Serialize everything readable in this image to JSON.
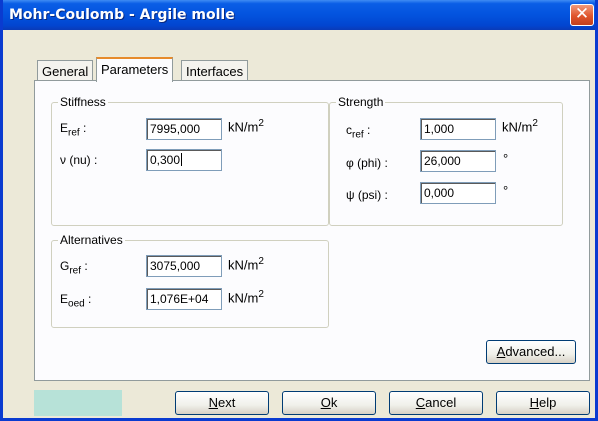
{
  "window": {
    "title": "Mohr-Coulomb - Argile molle",
    "close_glyph": "✕"
  },
  "tabs": [
    {
      "label": "General",
      "active": false
    },
    {
      "label": "Parameters",
      "active": true
    },
    {
      "label": "Interfaces",
      "active": false
    }
  ],
  "stiffness": {
    "title": "Stiffness",
    "e_ref": {
      "label_main": "E",
      "label_sub": "ref",
      "label_tail": " :",
      "value": "7995,000",
      "unit_main": "kN/m",
      "unit_sup": "2"
    },
    "nu": {
      "label": "ν (nu) :",
      "value": "0,300"
    }
  },
  "strength": {
    "title": "Strength",
    "c_ref": {
      "label_main": "c",
      "label_sub": "ref",
      "label_tail": " :",
      "value": "1,000",
      "unit_main": "kN/m",
      "unit_sup": "2"
    },
    "phi": {
      "label": "φ (phi) :",
      "value": "26,000",
      "unit": "°"
    },
    "psi": {
      "label": "ψ (psi) :",
      "value": "0,000",
      "unit": "°"
    }
  },
  "alternatives": {
    "title": "Alternatives",
    "g_ref": {
      "label_main": "G",
      "label_sub": "ref",
      "label_tail": " :",
      "value": "3075,000",
      "unit_main": "kN/m",
      "unit_sup": "2"
    },
    "e_oed": {
      "label_main": "E",
      "label_sub": "oed",
      "label_tail": " :",
      "value": "1,076E+04",
      "unit_main": "kN/m",
      "unit_sup": "2"
    }
  },
  "buttons": {
    "advanced": {
      "accel": "A",
      "rest": "dvanced..."
    },
    "next": {
      "accel": "N",
      "rest": "ext"
    },
    "ok": {
      "accel": "O",
      "rest": "k"
    },
    "cancel": {
      "accel": "C",
      "rest": "ancel"
    },
    "help": {
      "accel": "H",
      "rest": "elp"
    }
  },
  "colors": {
    "titlebar": "#0353de",
    "dialog_bg": "#ece9d8",
    "status_swatch": "#b7e2d8"
  }
}
